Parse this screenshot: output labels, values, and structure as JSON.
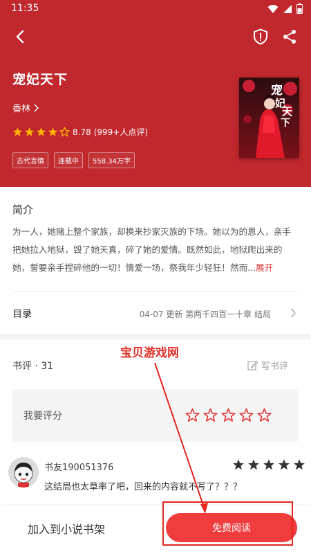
{
  "status_bar": {
    "time": "11:35"
  },
  "book": {
    "title": "宠妃天下",
    "author": "香林",
    "rating": 8.78,
    "rating_max_stars": 5,
    "rating_filled_stars": 4,
    "rating_count": "(999+人点评)",
    "tags": [
      "古代言情",
      "连载中",
      "558.34万字"
    ],
    "cover_title": "宠妃天下"
  },
  "intro": {
    "heading": "简介",
    "text": "为一人，她赌上整个家族，却换来抄家灭族的下场。她以为的恩人，亲手把她拉入地狱，毁了她天真，碎了她的爱情。既然如此，地狱爬出来的她，誓要亲手捏碎他的一切！情爱一场，祭我年少轻狂！然而...",
    "expand_label": "展开"
  },
  "toc": {
    "label": "目录",
    "latest": "04-07  更新  第两千四百一十章   结局"
  },
  "reviews": {
    "heading": "书评 · 31",
    "write_label": "写书评",
    "rate_label": "我要评分",
    "rate_stars": 5,
    "items": [
      {
        "user": "书友190051376",
        "stars": 5,
        "text": "这结局也太草率了吧，回来的内容就不写了？？？"
      }
    ]
  },
  "watermark": "宝贝游戏网",
  "bottom": {
    "shelf_label": "加入到小说书架",
    "read_label": "免费阅读"
  },
  "colors": {
    "brand_red": "#c0282d",
    "button_red": "#f03c3c",
    "star_gold": "#ffb400"
  }
}
